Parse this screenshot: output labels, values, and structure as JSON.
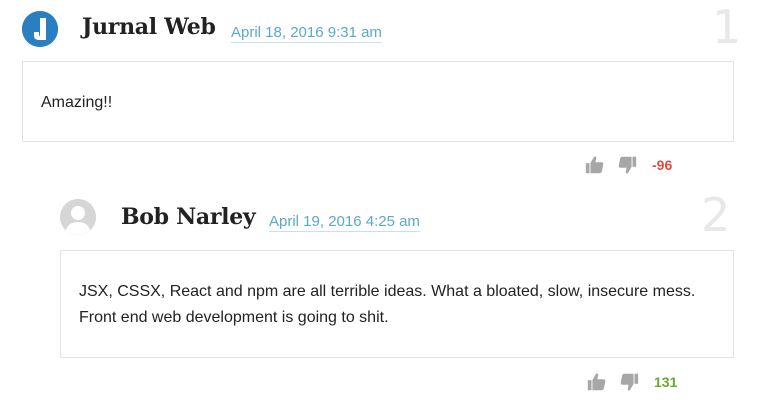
{
  "comments": [
    {
      "number": "1",
      "author": "Jurnal Web",
      "date": "April 18, 2016 9:31 am",
      "text": "Amazing!!",
      "score": "-96",
      "score_color": "#e24b3b",
      "avatar_color": "#2a7fc1",
      "avatar_icon": "j-logo-icon"
    },
    {
      "number": "2",
      "author": "Bob Narley",
      "date": "April 19, 2016 4:25 am",
      "text": "JSX, CSSX, React and npm are all terrible ideas. What a bloated, slow, insecure mess. Front end web development is going to shit.",
      "score": "131",
      "score_color": "#6aa82e",
      "avatar_color": "#d6d6d6",
      "avatar_icon": "default-user-icon"
    }
  ],
  "colors": {
    "link": "#5aa9cc",
    "icon_gray": "#a7a7a7",
    "number_gray": "#e8e8e8"
  }
}
